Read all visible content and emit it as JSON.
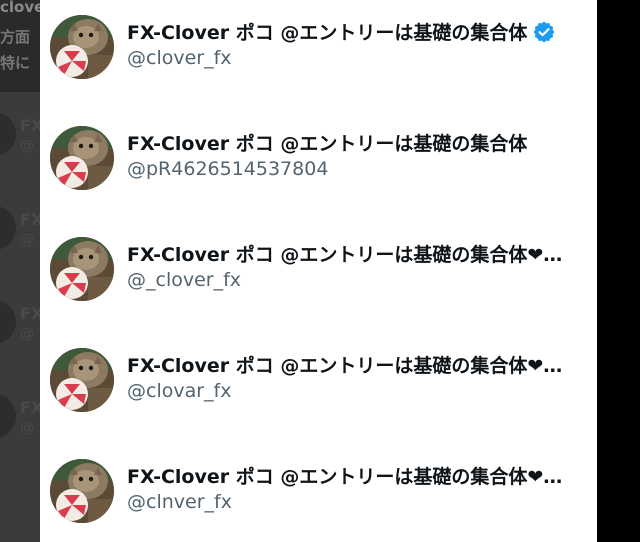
{
  "background_timeline": {
    "lines": [
      "clover/",
      "方面",
      "特に"
    ],
    "rows": [
      {
        "name": "FX",
        "handle": "@"
      },
      {
        "name": "FX",
        "handle": "@"
      },
      {
        "name": "FX",
        "handle": "@"
      },
      {
        "name": "FX",
        "handle": "@"
      }
    ]
  },
  "accounts": [
    {
      "display_name": "FX-Clover ポコ @エントリーは基礎の集合体",
      "handle": "@clover_fx",
      "verified": true
    },
    {
      "display_name": "FX-Clover ポコ @エントリーは基礎の集合体",
      "handle": "@pR4626514537804",
      "verified": false
    },
    {
      "display_name": "FX-Clover ポコ @エントリーは基礎の集合体❤…",
      "handle": "@_clover_fx",
      "verified": false
    },
    {
      "display_name": "FX-Clover ポコ @エントリーは基礎の集合体❤…",
      "handle": "@clovar_fx",
      "verified": false
    },
    {
      "display_name": "FX-Clover ポコ @エントリーは基礎の集合体❤…",
      "handle": "@clnver_fx",
      "verified": false
    }
  ],
  "colors": {
    "verified_badge": "#1d9bf0",
    "name_text": "#0f1419",
    "handle_text": "#536471"
  }
}
